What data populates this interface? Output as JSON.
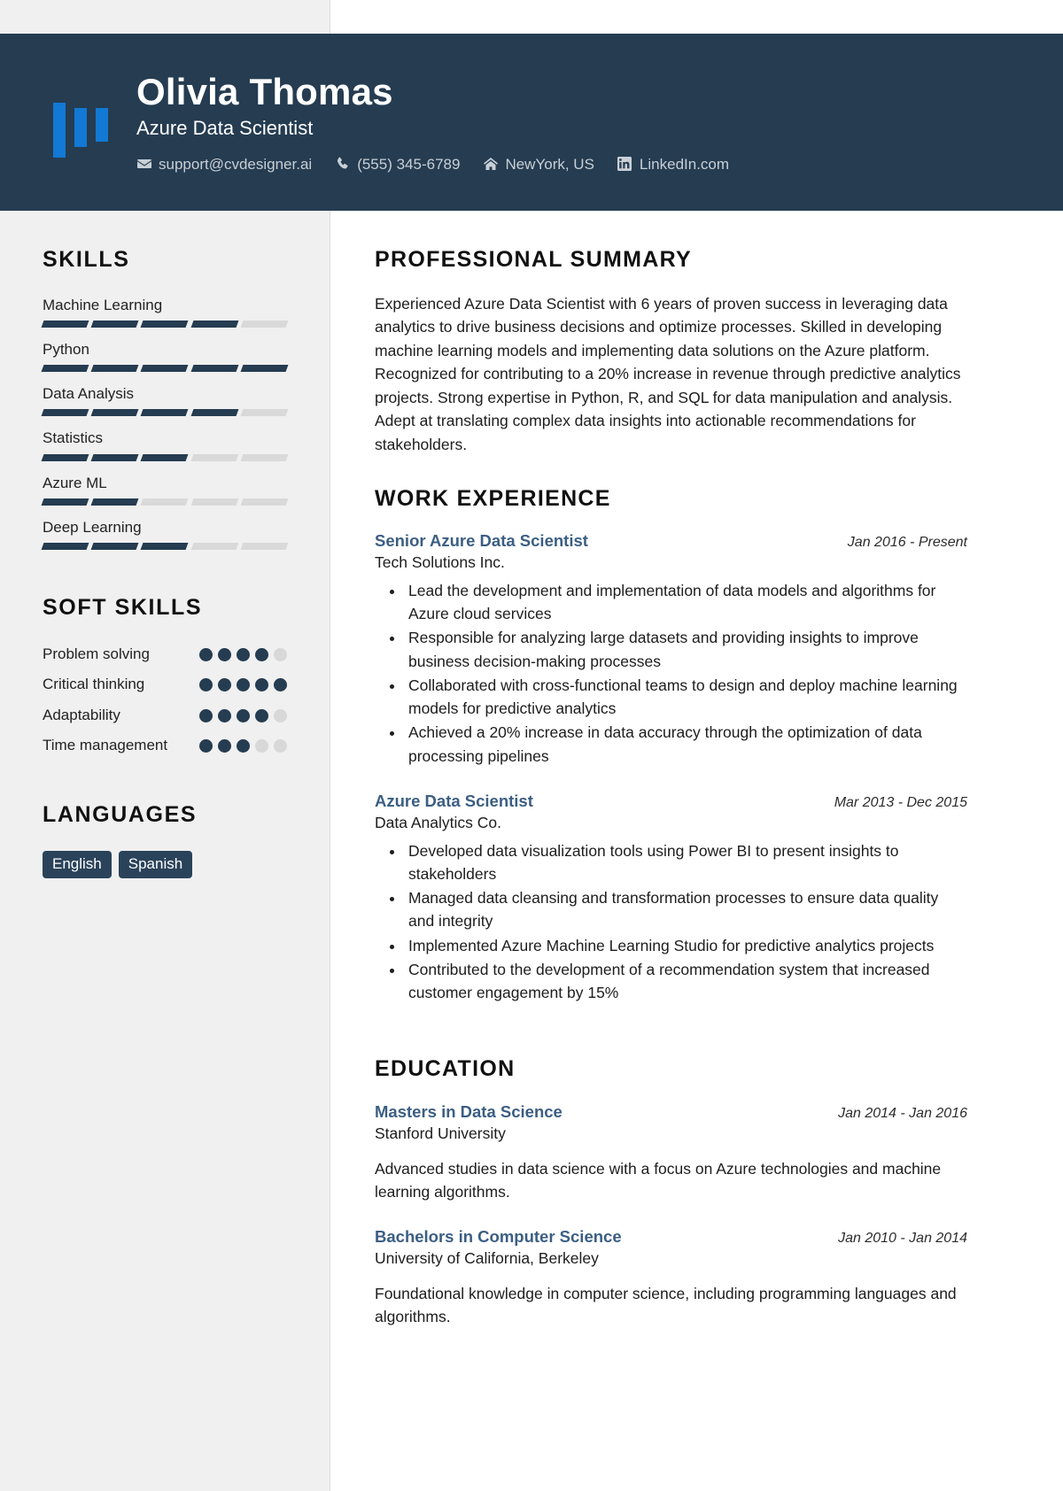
{
  "theme": {
    "navy": "#253c51",
    "accent_blue": "#1279d4",
    "title_blue": "#3b5e83",
    "sidebar_bg": "#f0f0f0",
    "bar_empty": "#d9d9d9"
  },
  "header": {
    "logo_icon": "bar-chart-logo",
    "name": "Olivia Thomas",
    "job_title": "Azure Data Scientist",
    "contacts": [
      {
        "icon": "envelope-icon",
        "text": "support@cvdesigner.ai"
      },
      {
        "icon": "phone-icon",
        "text": "(555) 345-6789"
      },
      {
        "icon": "home-icon",
        "text": "NewYork, US"
      },
      {
        "icon": "linkedin-icon",
        "text": "LinkedIn.com"
      }
    ]
  },
  "sidebar": {
    "skills_heading": "SKILLS",
    "skills_max": 5,
    "skills": [
      {
        "name": "Machine Learning",
        "level": 4
      },
      {
        "name": "Python",
        "level": 5
      },
      {
        "name": "Data Analysis",
        "level": 4
      },
      {
        "name": "Statistics",
        "level": 3
      },
      {
        "name": "Azure ML",
        "level": 2
      },
      {
        "name": "Deep Learning",
        "level": 3
      }
    ],
    "soft_skills_heading": "SOFT SKILLS",
    "soft_skills_max": 5,
    "soft_skills": [
      {
        "name": "Problem solving",
        "level": 4
      },
      {
        "name": "Critical thinking",
        "level": 5
      },
      {
        "name": "Adaptability",
        "level": 4
      },
      {
        "name": "Time management",
        "level": 3
      }
    ],
    "languages_heading": "LANGUAGES",
    "languages": [
      "English",
      "Spanish"
    ]
  },
  "main": {
    "summary_heading": "PROFESSIONAL SUMMARY",
    "summary_text": "Experienced Azure Data Scientist with 6 years of proven success in leveraging data analytics to drive business decisions and optimize processes. Skilled in developing machine learning models and implementing data solutions on the Azure platform. Recognized for contributing to a 20% increase in revenue through predictive analytics projects. Strong expertise in Python, R, and SQL for data manipulation and analysis. Adept at translating complex data insights into actionable recommendations for stakeholders.",
    "experience_heading": "WORK EXPERIENCE",
    "experience": [
      {
        "title": "Senior Azure Data Scientist",
        "date": "Jan 2016 - Present",
        "org": "Tech Solutions Inc.",
        "bullets": [
          "Lead the development and implementation of data models and algorithms for Azure cloud services",
          "Responsible for analyzing large datasets and providing insights to improve business decision-making processes",
          "Collaborated with cross-functional teams to design and deploy machine learning models for predictive analytics",
          "Achieved a 20% increase in data accuracy through the optimization of data processing pipelines"
        ]
      },
      {
        "title": "Azure Data Scientist",
        "date": "Mar 2013 - Dec 2015",
        "org": "Data Analytics Co.",
        "bullets": [
          "Developed data visualization tools using Power BI to present insights to stakeholders",
          "Managed data cleansing and transformation processes to ensure data quality and integrity",
          "Implemented Azure Machine Learning Studio for predictive analytics projects",
          "Contributed to the development of a recommendation system that increased customer engagement by 15%"
        ]
      }
    ],
    "education_heading": "EDUCATION",
    "education": [
      {
        "title": "Masters in Data Science",
        "date": "Jan 2014 - Jan 2016",
        "org": "Stanford University",
        "description": "Advanced studies in data science with a focus on Azure technologies and machine learning algorithms."
      },
      {
        "title": "Bachelors in Computer Science",
        "date": "Jan 2010 - Jan 2014",
        "org": "University of California, Berkeley",
        "description": "Foundational knowledge in computer science, including programming languages and algorithms."
      }
    ]
  }
}
